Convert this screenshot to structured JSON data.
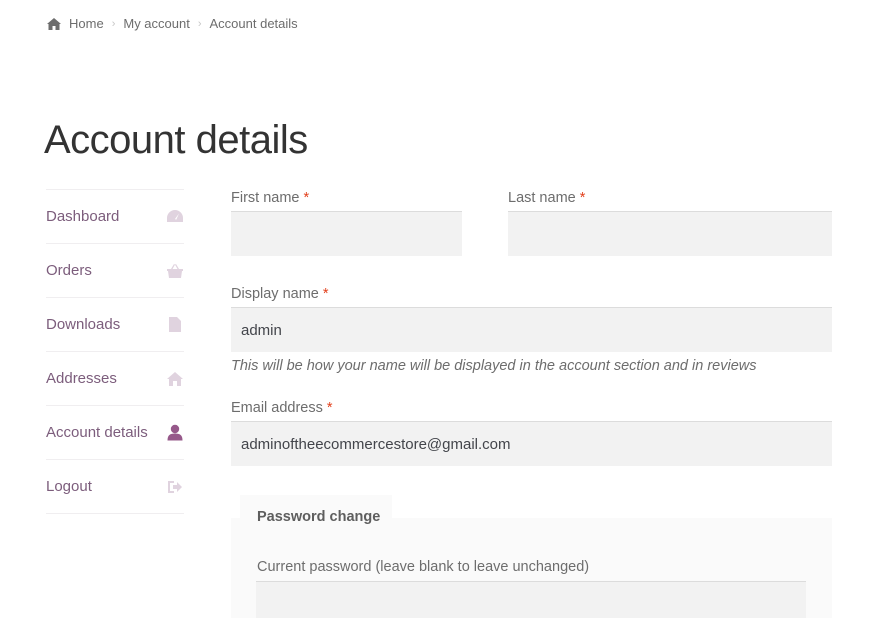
{
  "breadcrumb": {
    "items": [
      "Home",
      "My account",
      "Account details"
    ],
    "separator": "›"
  },
  "page": {
    "title": "Account details"
  },
  "nav": {
    "items": [
      {
        "label": "Dashboard",
        "icon": "dashboard-gauge-icon",
        "active": false
      },
      {
        "label": "Orders",
        "icon": "basket-icon",
        "active": false
      },
      {
        "label": "Downloads",
        "icon": "file-archive-icon",
        "active": false
      },
      {
        "label": "Addresses",
        "icon": "home-icon",
        "active": false
      },
      {
        "label": "Account details",
        "icon": "user-icon",
        "active": true
      },
      {
        "label": "Logout",
        "icon": "sign-out-icon",
        "active": false
      }
    ]
  },
  "form": {
    "first_name": {
      "label": "First name",
      "required": "*",
      "value": ""
    },
    "last_name": {
      "label": "Last name",
      "required": "*",
      "value": ""
    },
    "display_name": {
      "label": "Display name",
      "required": "*",
      "value": "admin",
      "hint": "This will be how your name will be displayed in the account section and in reviews"
    },
    "email": {
      "label": "Email address",
      "required": "*",
      "value": "adminoftheecommercestore@gmail.com"
    },
    "password_change": {
      "legend": "Password change",
      "current_password": {
        "label": "Current password (leave blank to leave unchanged)",
        "value": ""
      }
    }
  },
  "colors": {
    "accent": "#96588a",
    "nav_text": "#7c5d7c",
    "required": "#e2401c",
    "input_bg": "#f2f2f2"
  }
}
